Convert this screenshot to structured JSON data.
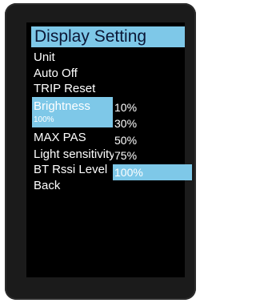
{
  "header": {
    "title": "Display Setting"
  },
  "menu": {
    "items": [
      {
        "label": "Unit"
      },
      {
        "label": "Auto Off"
      },
      {
        "label": "TRIP Reset"
      },
      {
        "label": "Brightness",
        "value": "100%"
      },
      {
        "label": "MAX PAS"
      },
      {
        "label": "Light sensitivity"
      },
      {
        "label": "BT Rssi Level"
      },
      {
        "label": "Back"
      }
    ]
  },
  "options": {
    "list": [
      "10%",
      "30%",
      "50%",
      "75%",
      "100%"
    ],
    "selected": "100%"
  },
  "colors": {
    "highlight": "#7ec8e8",
    "title_text": "#0b1736",
    "screen_bg": "#000000",
    "bezel": "#1b1b1b"
  }
}
